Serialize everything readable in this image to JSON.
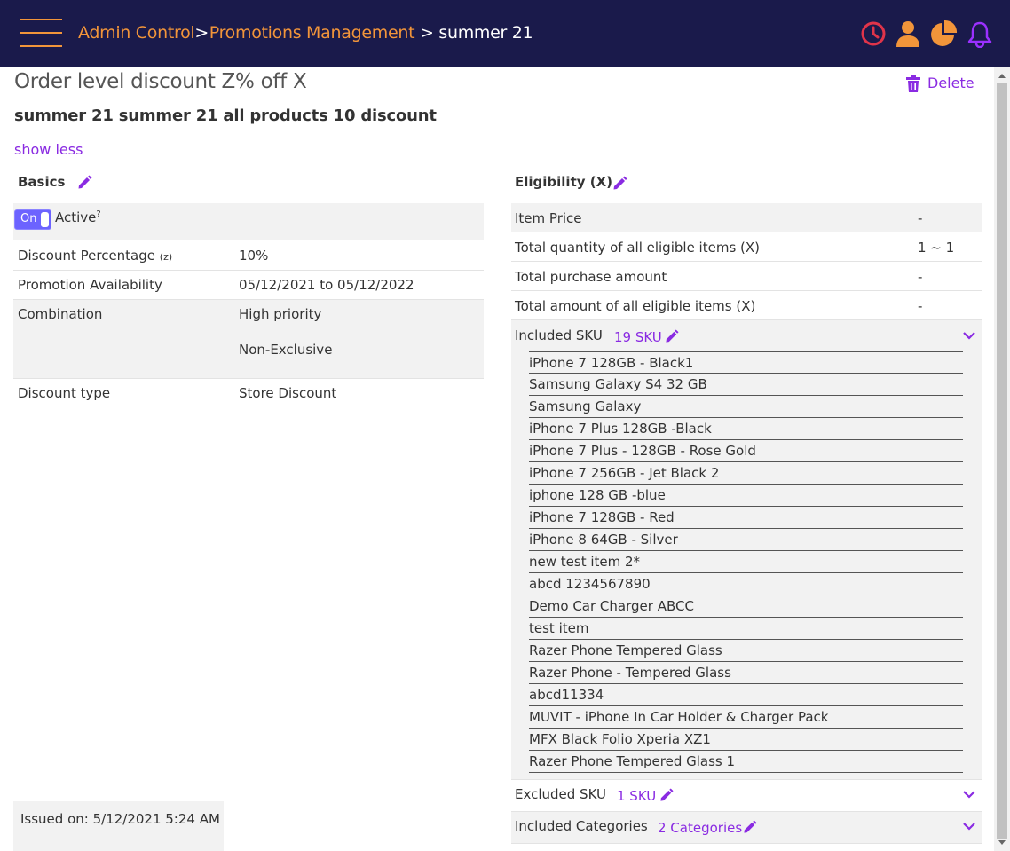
{
  "header": {
    "breadcrumbs": [
      {
        "label": "Admin Control"
      },
      {
        "label": "Promotions Management"
      }
    ],
    "separator": ">",
    "current": "summer 21",
    "icons": [
      "clock-icon",
      "user-icon",
      "pie-chart-icon",
      "bell-icon"
    ],
    "colors": {
      "bar": "#1a1a4b",
      "accent": "#f2953a",
      "clock": "#e0344a",
      "bell": "#9b30ff"
    }
  },
  "promotion": {
    "title": "Order level discount Z% off X",
    "subtitle": "summer 21 summer 21 all products 10 discount",
    "show_less": "show less",
    "delete_label": "Delete"
  },
  "basics": {
    "title": "Basics",
    "toggle_label": "On",
    "active_label": "Active",
    "active_help": "?",
    "rows": {
      "discount_percentage": {
        "label": "Discount Percentage",
        "suffix": "(z)",
        "value": "10%"
      },
      "availability": {
        "label": "Promotion Availability",
        "value": "05/12/2021 to 05/12/2022"
      },
      "combination": {
        "label": "Combination",
        "values": [
          "High priority",
          "Non-Exclusive"
        ]
      },
      "discount_type": {
        "label": "Discount type",
        "value": "Store Discount"
      }
    }
  },
  "eligibility": {
    "title": "Eligibility (X)",
    "rows": [
      {
        "label": "Item Price",
        "value": "-"
      },
      {
        "label": "Total quantity of all eligible items (X)",
        "value": "1 ~ 1"
      },
      {
        "label": "Total purchase amount",
        "value": "-"
      },
      {
        "label": "Total amount of all eligible items (X)",
        "value": "-"
      }
    ],
    "included_sku": {
      "label": "Included SKU",
      "count": "19 SKU",
      "items": [
        "iPhone 7 128GB - Black1",
        "Samsung Galaxy S4 32 GB",
        "Samsung Galaxy",
        "iPhone 7 Plus 128GB -Black",
        "iPhone 7 Plus - 128GB - Rose Gold",
        "iPhone 7 256GB - Jet Black 2",
        "iphone 128 GB -blue",
        "iPhone 7 128GB - Red",
        "iPhone 8 64GB - Silver",
        "new test item 2*",
        "abcd 1234567890",
        "Demo Car Charger ABCC",
        "test item",
        "Razer Phone Tempered Glass",
        "Razer Phone - Tempered Glass",
        "abcd11334",
        "MUVIT - iPhone In Car Holder & Charger Pack",
        "MFX Black Folio Xperia XZ1",
        "Razer Phone Tempered Glass 1"
      ]
    },
    "excluded_sku": {
      "label": "Excluded SKU",
      "count": "1 SKU"
    },
    "included_categories": {
      "label": "Included Categories",
      "count": "2 Categories"
    }
  },
  "footer": {
    "issued": "Issued on: 5/12/2021 5:24 AM"
  },
  "theme": {
    "link": "#8a2be2",
    "toggle": "#6c63ff",
    "row_shade": "#f2f2f2"
  }
}
